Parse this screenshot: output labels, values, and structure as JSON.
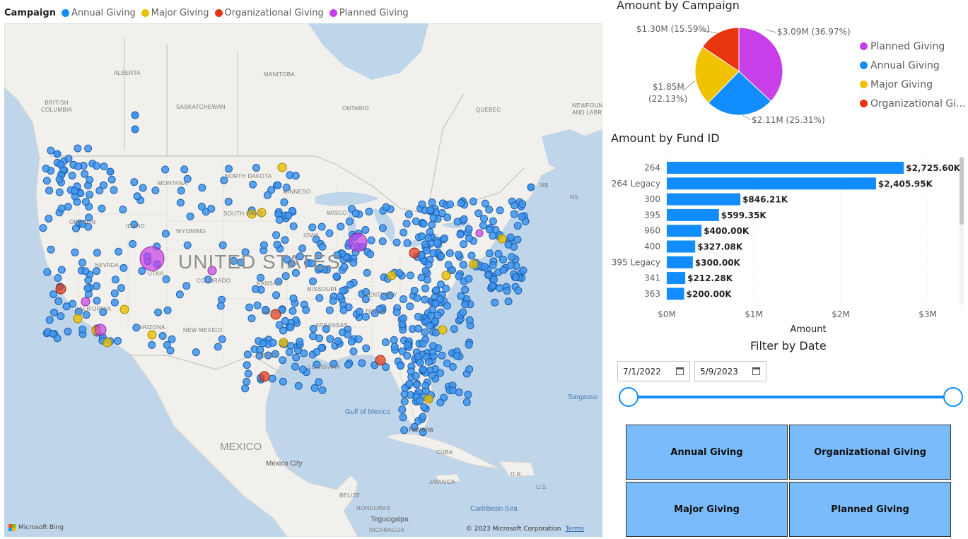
{
  "map": {
    "legend": {
      "title": "Campaign",
      "items": [
        {
          "label": "Annual Giving",
          "color": "#118dff"
        },
        {
          "label": "Major Giving",
          "color": "#e8c000"
        },
        {
          "label": "Organizational Giving",
          "color": "#e8340f"
        },
        {
          "label": "Planned Giving",
          "color": "#c83ee8"
        }
      ]
    },
    "labels": {
      "alberta": "ALBERTA",
      "british_columbia": "BRITISH\nCOLUMBIA",
      "saskatchewan": "SASKATCHEWAN",
      "manitoba": "MANITOBA",
      "ontario": "ONTARIO",
      "quebec": "QUEBEC",
      "newfoundland": "NEWFOUND\nAND LABR",
      "nb": "NB",
      "ns": "NS",
      "montana": "MONTANA",
      "north_dakota": "NORTH DAKOTA",
      "minnesota": "MINNESO",
      "south_dakota": "SOUTH DAKO",
      "wisconsin": "WISCO",
      "oregon": "OREGON",
      "idaho": "IDAHO",
      "wyoming": "WYOMING",
      "iowa": "IOWA",
      "nevada": "NEVADA",
      "utah": "UTAH",
      "colorado": "COLORADO",
      "kansas": "KANSAS",
      "missouri": "MISSOURI",
      "california": "CALIFORNIA",
      "arizona": "ARIZONA",
      "new_mexico": "NEW MEXICO",
      "oklahoma": "OKLA",
      "arkansas": "ARKANSAS",
      "kentucky": "KENTUCKY",
      "tennessee": "TENNE",
      "texas": "TEXAS",
      "louisiana": "LOUISIANA",
      "united_states": "UNITED STATES",
      "mexico": "MEXICO",
      "gulf": "Gulf of Mexico",
      "havana": "Havana",
      "cuba": "CUBA",
      "jamaica": "JAMAICA",
      "dr": "D.R.",
      "mexico_city": "Mexico City",
      "belize": "BELIZE",
      "honduras": "HONDURAS",
      "tegucigalpa": "Tegucigalpa",
      "nicaragua": "NICARAGUA",
      "caribbean": "Caribbean Sea",
      "sargasso": "Sargasso",
      "us_vi": "U.S.",
      "bing": "Microsoft Bing",
      "copyright": "© 2023 Microsoft Corporation",
      "terms": "Terms"
    }
  },
  "pie": {
    "title": "Amount by Campaign",
    "labels": {
      "planned": "$3.09M (36.97%)",
      "annual": "$2.11M (25.31%)",
      "major_a": "$1.85M",
      "major_b": "(22.13%)",
      "org": "$1.30M (15.59%)"
    },
    "legend": [
      {
        "label": "Planned Giving",
        "color": "#c83ee8"
      },
      {
        "label": "Annual Giving",
        "color": "#118dff"
      },
      {
        "label": "Major Giving",
        "color": "#f0c200"
      },
      {
        "label": "Organizational Gi...",
        "color": "#e8340f"
      }
    ]
  },
  "chart_data": [
    {
      "type": "pie",
      "title": "Amount by Campaign",
      "slices": [
        {
          "label": "Planned Giving",
          "value": 3.09,
          "percent": 36.97,
          "color": "#c83ee8"
        },
        {
          "label": "Annual Giving",
          "value": 2.11,
          "percent": 25.31,
          "color": "#118dff"
        },
        {
          "label": "Major Giving",
          "value": 1.85,
          "percent": 22.13,
          "color": "#f0c200"
        },
        {
          "label": "Organizational Giving",
          "value": 1.3,
          "percent": 15.59,
          "color": "#e8340f"
        }
      ],
      "unit": "$M",
      "legend": "right"
    },
    {
      "type": "bar",
      "orientation": "horizontal",
      "title": "Amount by Fund ID",
      "categories": [
        "264",
        "264 Legacy",
        "300",
        "395",
        "960",
        "400",
        "395 Legacy",
        "341",
        "363"
      ],
      "values": [
        2725.6,
        2405.95,
        846.21,
        599.35,
        400.0,
        327.08,
        300.0,
        212.28,
        200.0
      ],
      "value_labels": [
        "$2,725.60K",
        "$2,405.95K",
        "$846.21K",
        "$599.35K",
        "$400.00K",
        "$327.08K",
        "$300.00K",
        "$212.28K",
        "$200.00K"
      ],
      "xlabel": "Amount",
      "ylabel": "",
      "xlim": [
        0,
        3000
      ],
      "xticks": [
        0,
        1000,
        2000,
        3000
      ],
      "xtick_labels": [
        "$0M",
        "$1M",
        "$2M",
        "$3M"
      ],
      "grid": true,
      "color": "#118dff"
    }
  ],
  "filter": {
    "title": "Filter by Date",
    "start": "7/1/2022",
    "end": "5/9/2023"
  },
  "buttons": {
    "annual": "Annual Giving",
    "organizational": "Organizational Giving",
    "major": "Major Giving",
    "planned": "Planned Giving"
  }
}
